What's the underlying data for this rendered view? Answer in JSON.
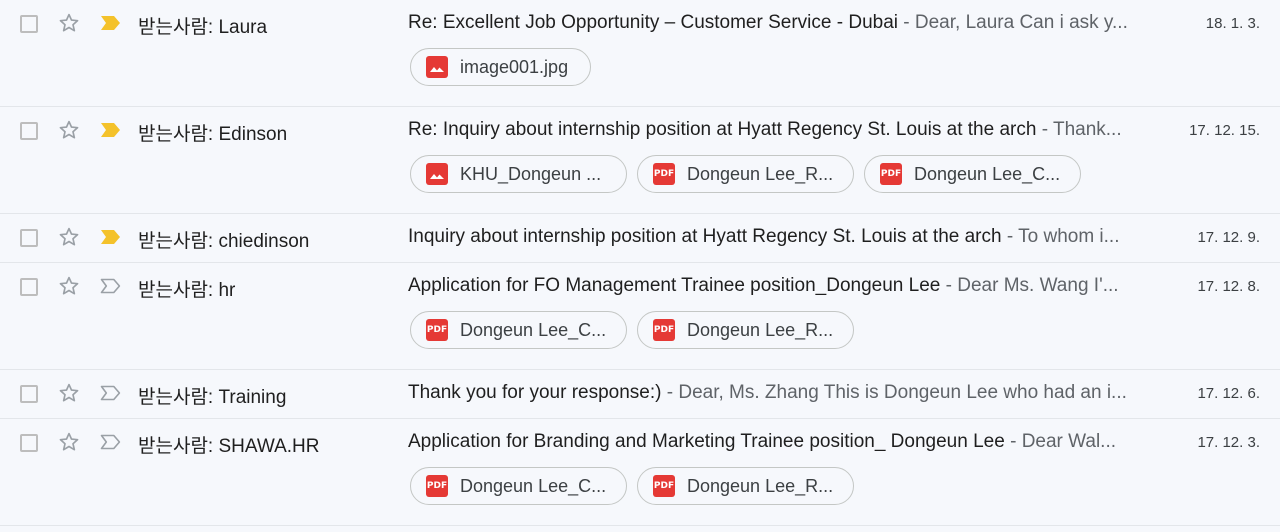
{
  "colors": {
    "important_yellow": "#f4c22b",
    "pdf_red": "#e53935",
    "background": "#f6f8fc"
  },
  "icons": {
    "checkbox": "checkbox-icon",
    "star": "star-icon",
    "important": "importance-marker-icon",
    "image_file": "image-file-icon",
    "pdf_file": "pdf-file-icon"
  },
  "pdf_badge": "PDF",
  "emails": [
    {
      "sender": "받는사람: Laura",
      "subject": "Re: Excellent Job Opportunity – Customer Service - Dubai",
      "separator": " - ",
      "snippet": "Dear, Laura Can i ask y...",
      "date": "18. 1. 3.",
      "important": true,
      "attachments": [
        {
          "type": "image",
          "name": "image001.jpg"
        }
      ]
    },
    {
      "sender": "받는사람: Edinson",
      "subject": "Re: Inquiry about internship position at Hyatt Regency St. Louis at the arch",
      "separator": " - ",
      "snippet": "Thank...",
      "date": "17. 12. 15.",
      "important": true,
      "attachments": [
        {
          "type": "image",
          "name": "KHU_Dongeun ..."
        },
        {
          "type": "pdf",
          "name": "Dongeun Lee_R..."
        },
        {
          "type": "pdf",
          "name": "Dongeun Lee_C..."
        }
      ]
    },
    {
      "sender": "받는사람: chiedinson",
      "subject": "Inquiry about internship position at Hyatt Regency St. Louis at the arch",
      "separator": " - ",
      "snippet": "To whom i...",
      "date": "17. 12. 9.",
      "important": true,
      "attachments": []
    },
    {
      "sender": "받는사람: hr",
      "subject": "Application for FO Management Trainee position_Dongeun Lee",
      "separator": " - ",
      "snippet": "Dear Ms. Wang I'...",
      "date": "17. 12. 8.",
      "important": false,
      "attachments": [
        {
          "type": "pdf",
          "name": "Dongeun Lee_C..."
        },
        {
          "type": "pdf",
          "name": "Dongeun Lee_R..."
        }
      ]
    },
    {
      "sender": "받는사람: Training",
      "subject": "Thank you for your response:)",
      "separator": " - ",
      "snippet": "Dear, Ms. Zhang This is Dongeun Lee who had an i...",
      "date": "17. 12. 6.",
      "important": false,
      "attachments": []
    },
    {
      "sender": "받는사람: SHAWA.HR",
      "subject": "Application for Branding and Marketing Trainee position_ Dongeun Lee",
      "separator": " - ",
      "snippet": "Dear Wal...",
      "date": "17. 12. 3.",
      "important": false,
      "attachments": [
        {
          "type": "pdf",
          "name": "Dongeun Lee_C..."
        },
        {
          "type": "pdf",
          "name": "Dongeun Lee_R..."
        }
      ]
    }
  ]
}
